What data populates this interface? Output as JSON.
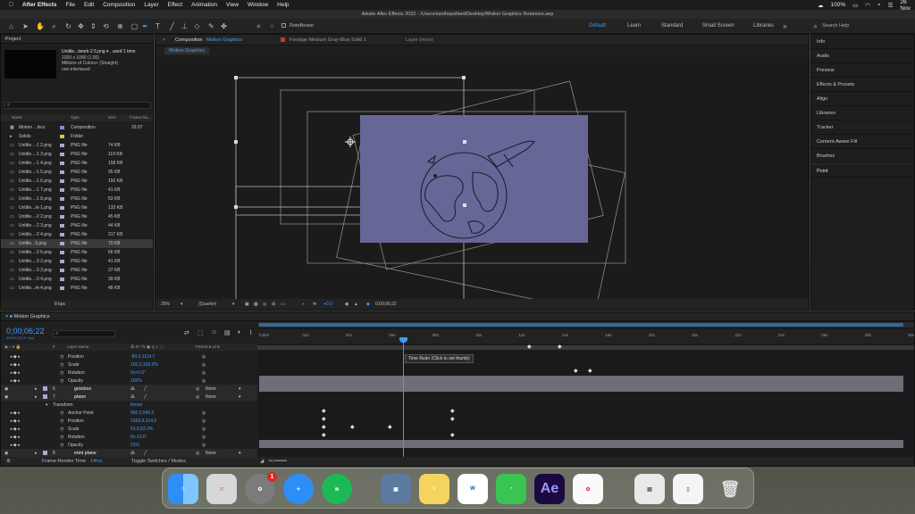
{
  "menubar": {
    "app_name": "After Effects",
    "menus": [
      "File",
      "Edit",
      "Composition",
      "Layer",
      "Effect",
      "Animation",
      "View",
      "Window",
      "Help"
    ],
    "battery": "100%",
    "datetime": "Fri 26 Nov  00:43"
  },
  "window_title": "Adobe After Effects 2022 - /Users/xanthepollard/Desktop/Motion Graphics Rotations.aep",
  "toolbar": {
    "roto_label": "RotoBezier",
    "workspaces": [
      "Default",
      "Learn",
      "Standard",
      "Small Screen",
      "Libraries"
    ],
    "active_workspace": "Default",
    "search_placeholder": "Search Help"
  },
  "project": {
    "title": "Project",
    "selected_name": "Untitle...twork-2 5.png ▾ , used 1 time",
    "info_lines": [
      "1920 x 1080 (1.00)",
      "",
      "Millions of Colors+ (Straight)",
      "non-interlaced"
    ],
    "columns": [
      "Name",
      "Type",
      "Size",
      "Frame Ra..."
    ],
    "items": [
      {
        "name": "Motion ...hics",
        "type": "Composition",
        "size": "",
        "fr": "29.97",
        "color": "#8a8ad0"
      },
      {
        "name": "Solids",
        "type": "Folder",
        "size": "",
        "fr": "",
        "color": "#d9c24a"
      },
      {
        "name": "Untitle...-1 2.png",
        "type": "PNG file",
        "size": "74 KB",
        "fr": "",
        "color": "#a9a9d6"
      },
      {
        "name": "Untitle...-1 3.png",
        "type": "PNG file",
        "size": "119 KB",
        "fr": "",
        "color": "#a9a9d6"
      },
      {
        "name": "Untitle...-1 4.png",
        "type": "PNG file",
        "size": "158 KB",
        "fr": "",
        "color": "#a9a9d6"
      },
      {
        "name": "Untitle...-1 5.png",
        "type": "PNG file",
        "size": "95 KB",
        "fr": "",
        "color": "#a9a9d6"
      },
      {
        "name": "Untitle...-1 6.png",
        "type": "PNG file",
        "size": "150 KB",
        "fr": "",
        "color": "#a9a9d6"
      },
      {
        "name": "Untitle...-1 7.png",
        "type": "PNG file",
        "size": "41 KB",
        "fr": "",
        "color": "#a9a9d6"
      },
      {
        "name": "Untitle...-1 8.png",
        "type": "PNG file",
        "size": "53 KB",
        "fr": "",
        "color": "#a9a9d6"
      },
      {
        "name": "Untitle...rk-1.png",
        "type": "PNG file",
        "size": "133 KB",
        "fr": "",
        "color": "#a9a9d6"
      },
      {
        "name": "Untitle...-2 2.png",
        "type": "PNG file",
        "size": "45 KB",
        "fr": "",
        "color": "#a9a9d6"
      },
      {
        "name": "Untitle...-2 3.png",
        "type": "PNG file",
        "size": "44 KB",
        "fr": "",
        "color": "#a9a9d6"
      },
      {
        "name": "Untitle...-2 4.png",
        "type": "PNG file",
        "size": "317 KB",
        "fr": "",
        "color": "#a9a9d6"
      },
      {
        "name": "Untitle...5.png",
        "type": "PNG file",
        "size": "70 KB",
        "fr": "",
        "color": "#a9a9d6",
        "selected": true
      },
      {
        "name": "Untitle...-2 6.png",
        "type": "PNG file",
        "size": "66 KB",
        "fr": "",
        "color": "#a9a9d6"
      },
      {
        "name": "Untitle...-3 2.png",
        "type": "PNG file",
        "size": "41 KB",
        "fr": "",
        "color": "#a9a9d6"
      },
      {
        "name": "Untitle...-3 3.png",
        "type": "PNG file",
        "size": "37 KB",
        "fr": "",
        "color": "#a9a9d6"
      },
      {
        "name": "Untitle...-3 4.png",
        "type": "PNG file",
        "size": "39 KB",
        "fr": "",
        "color": "#a9a9d6"
      },
      {
        "name": "Untitle...rk-4.png",
        "type": "PNG file",
        "size": "48 KB",
        "fr": "",
        "color": "#a9a9d6"
      }
    ],
    "bpc": "8 bpc"
  },
  "composition": {
    "tab_label": "Composition",
    "tab_name": "Motion Graphics",
    "footage_label": "Footage Medium Gray-Blue Solid 1",
    "layer_label": "Layer (none)",
    "chip": "Motion Graphics",
    "zoom": "25%",
    "resolution": "(Quarter)",
    "exposure": "+0.0",
    "timecode": "0;00;06;22",
    "bg_color": "#676797"
  },
  "right_panels": [
    "Info",
    "Audio",
    "Preview",
    "Effects & Presets",
    "Align",
    "Libraries",
    "Tracker",
    "Content-Aware Fill",
    "Brushes",
    "Point"
  ],
  "timeline": {
    "title": "Motion Graphics",
    "timecode": "0;00;06;22",
    "timecode_sub": "00202 (29.97 fps)",
    "col_layer_name": "Layer Name",
    "col_parent": "Parent & Link",
    "ruler": [
      "0:00s",
      "02s",
      "04s",
      "06s",
      "08s",
      "10s",
      "12s",
      "14s",
      "16s",
      "18s",
      "20s",
      "22s",
      "24s",
      "26s",
      "28s",
      "30s"
    ],
    "tooltip": "Time Ruler (Click to set thumb)",
    "rows": [
      {
        "kind": "prop",
        "label": "Position",
        "value": "-80.0,1114.7",
        "indent": 1
      },
      {
        "kind": "prop",
        "label": "Scale",
        "value": "100.0,100.0%",
        "indent": 1
      },
      {
        "kind": "prop",
        "label": "Rotation",
        "value": "0x+0.0°",
        "indent": 1
      },
      {
        "kind": "prop",
        "label": "Opacity",
        "value": "100%",
        "indent": 1
      },
      {
        "kind": "layer",
        "num": "6",
        "label": "getebox",
        "parent": "None"
      },
      {
        "kind": "layer",
        "num": "7",
        "label": "plane",
        "parent": "None"
      },
      {
        "kind": "group",
        "label": "Transform",
        "value": "Reset"
      },
      {
        "kind": "prop",
        "label": "Anchor Point",
        "value": "960.0,540.0",
        "indent": 1
      },
      {
        "kind": "prop",
        "label": "Position",
        "value": "1369.9,324.6",
        "indent": 1
      },
      {
        "kind": "prop",
        "label": "Scale",
        "value": "53.6,53.2%",
        "indent": 1
      },
      {
        "kind": "prop",
        "label": "Rotation",
        "value": "0x-13.6°",
        "indent": 1
      },
      {
        "kind": "prop",
        "label": "Opacity",
        "value": "31%",
        "indent": 1
      },
      {
        "kind": "layer",
        "num": "8",
        "label": "mini plane",
        "parent": "None"
      }
    ],
    "footer_render": "Frame Render Time",
    "footer_ms": "14ms",
    "footer_toggle": "Toggle Switches / Modes"
  },
  "dock": {
    "settings_badge": "1",
    "ae_label": "Ae"
  }
}
